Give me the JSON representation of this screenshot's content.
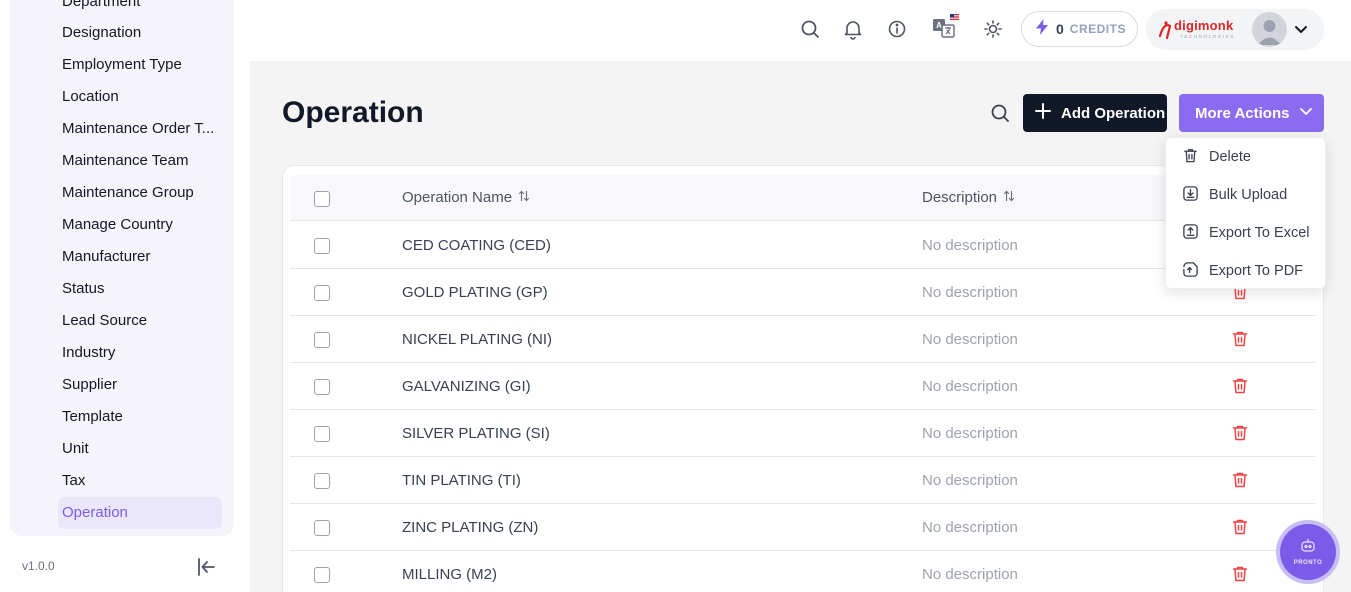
{
  "sidebar": {
    "items": [
      {
        "label": "Department",
        "active": false
      },
      {
        "label": "Designation",
        "active": false
      },
      {
        "label": "Employment Type",
        "active": false
      },
      {
        "label": "Location",
        "active": false
      },
      {
        "label": "Maintenance Order T...",
        "active": false
      },
      {
        "label": "Maintenance Team",
        "active": false
      },
      {
        "label": "Maintenance Group",
        "active": false
      },
      {
        "label": "Manage Country",
        "active": false
      },
      {
        "label": "Manufacturer",
        "active": false
      },
      {
        "label": "Status",
        "active": false
      },
      {
        "label": "Lead Source",
        "active": false
      },
      {
        "label": "Industry",
        "active": false
      },
      {
        "label": "Supplier",
        "active": false
      },
      {
        "label": "Template",
        "active": false
      },
      {
        "label": "Unit",
        "active": false
      },
      {
        "label": "Tax",
        "active": false
      },
      {
        "label": "Operation",
        "active": true
      }
    ],
    "version": "v1.0.0"
  },
  "header": {
    "credits_value": "0",
    "credits_label": "CREDITS",
    "brand": "digimonk",
    "brand_sub": "TECHNOLOGIES"
  },
  "page": {
    "title": "Operation",
    "add_button": "Add Operation",
    "more_button": "More Actions"
  },
  "table": {
    "columns": [
      "Operation Name",
      "Description"
    ],
    "rows": [
      {
        "name": "CED COATING (CED)",
        "description": "No description"
      },
      {
        "name": "GOLD PLATING (GP)",
        "description": "No description"
      },
      {
        "name": "NICKEL PLATING (NI)",
        "description": "No description"
      },
      {
        "name": "GALVANIZING (GI)",
        "description": "No description"
      },
      {
        "name": "SILVER PLATING (SI)",
        "description": "No description"
      },
      {
        "name": "TIN PLATING (TI)",
        "description": "No description"
      },
      {
        "name": "ZINC PLATING (ZN)",
        "description": "No description"
      },
      {
        "name": "MILLING (M2)",
        "description": "No description"
      }
    ]
  },
  "dropdown": {
    "items": [
      {
        "label": "Delete",
        "icon": "trash-icon"
      },
      {
        "label": "Bulk Upload",
        "icon": "download-box-icon"
      },
      {
        "label": "Export To Excel",
        "icon": "upload-box-icon"
      },
      {
        "label": "Export To PDF",
        "icon": "file-export-icon"
      }
    ]
  },
  "fab": {
    "label": "PRONTO"
  },
  "colors": {
    "accent": "#8b6cf0",
    "dark_button": "#111827",
    "danger": "#ef4444",
    "active_bg": "#ebe7fb"
  }
}
